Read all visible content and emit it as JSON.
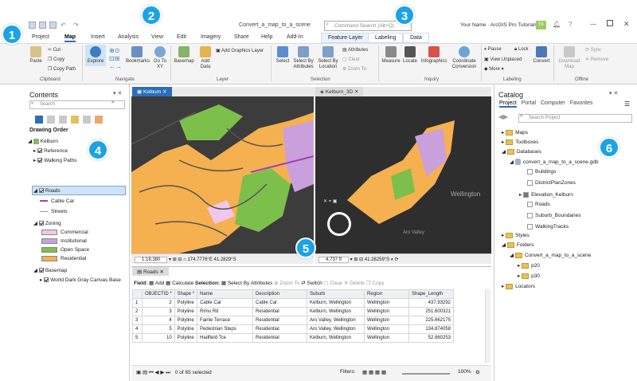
{
  "window": {
    "title": "Convert_a_map_to_a_scene",
    "app": "ArcGIS Pro Tutorials",
    "user": "Your Name",
    "user_badge": "TK",
    "help": "?"
  },
  "command_search": {
    "placeholder": "Command Search (Alt+Q)"
  },
  "ribbon_tabs": [
    "Project",
    "Map",
    "Insert",
    "Analysis",
    "View",
    "Edit",
    "Imagery",
    "Share",
    "Help",
    "Add-In"
  ],
  "active_tab": "Map",
  "context_tabs": {
    "group": "Feature Layer",
    "items": [
      "Labeling",
      "Data"
    ]
  },
  "ribbon": {
    "clipboard": {
      "label": "Clipboard",
      "paste": "Paste",
      "cut": "Cut",
      "copy": "Copy",
      "copy_path": "Copy Path"
    },
    "navigate": {
      "label": "Navigate",
      "explore": "Explore",
      "bookmarks": "Bookmarks",
      "goto": "Go To XY"
    },
    "layer": {
      "label": "Layer",
      "basemap": "Basemap",
      "add_data": "Add Data",
      "add_graphics": "Add Graphics Layer"
    },
    "selection": {
      "label": "Selection",
      "select": "Select",
      "by_attr": "Select By Attributes",
      "by_loc": "Select By Location",
      "attributes": "Attributes",
      "clear": "Clear",
      "zoom_to": "Zoom To"
    },
    "inquiry": {
      "label": "Inquiry",
      "measure": "Measure",
      "locate": "Locate",
      "infographics": "Infographics",
      "coord": "Coordinate Conversion"
    },
    "labeling": {
      "label": "Labeling",
      "pause": "Pause",
      "lock": "Lock",
      "view_unplaced": "View Unplaced",
      "more": "More",
      "convert": "Convert"
    },
    "offline": {
      "label": "Offline",
      "download": "Download Map",
      "sync": "Sync",
      "remove": "Remove"
    }
  },
  "contents": {
    "title": "Contents",
    "search_placeholder": "Search",
    "drawing_order": "Drawing Order",
    "map_name": "Kelburn",
    "layers": {
      "reference": "Reference",
      "walking": "Walking Paths",
      "roads": "Roads",
      "cable": "Cable Car",
      "streets": "Streets",
      "zoning": "Zoning",
      "zones": [
        {
          "label": "Commercial",
          "color": "#f2c6ea"
        },
        {
          "label": "Institutional",
          "color": "#c9a0dc"
        },
        {
          "label": "Open Space",
          "color": "#7cbf4a"
        },
        {
          "label": "Residential",
          "color": "#f5b050"
        }
      ],
      "basemap": "Basemap",
      "basemap_item": "World Dark Gray Canvas Base"
    }
  },
  "map_tabs": [
    "Kelburn",
    "Kelburn_3D"
  ],
  "map": {
    "scale": "1:18,380",
    "coords": "174.7776°E 41.2829°S",
    "scene_scale": "4,737 ft",
    "scene_coords": "41.28259°S",
    "label_wellington": "Wellington",
    "label_aro": "Aro Valley"
  },
  "table": {
    "tab": "Roads",
    "toolbar": {
      "field": "Field:",
      "add": "Add",
      "calculate": "Calculate",
      "selection": "Selection:",
      "select_by_attr": "Select By Attributes",
      "zoom_to": "Zoom To",
      "switch": "Switch",
      "clear": "Clear",
      "delete": "Delete",
      "copy": "Copy"
    },
    "columns": [
      "OBJECTID *",
      "Shape *",
      "Name",
      "Description",
      "Suburb",
      "Region",
      "Shape_Length"
    ],
    "rows": [
      [
        "1",
        "2",
        "Polyline",
        "Cable Car",
        "Cable Car",
        "Kelburn, Wellington",
        "Wellington",
        "437.93292"
      ],
      [
        "2",
        "3",
        "Polyline",
        "Rimu Rd",
        "Residential",
        "Kelburn, Wellington",
        "Wellington",
        "251.600321"
      ],
      [
        "3",
        "4",
        "Polyline",
        "Fairlie Terrace",
        "Residential",
        "Aro Valley, Wellington",
        "Wellington",
        "225.662175"
      ],
      [
        "4",
        "5",
        "Polyline",
        "Pedestrian Steps",
        "Residential",
        "Aro Valley, Wellington",
        "Wellington",
        "134.874058"
      ],
      [
        "5",
        "10",
        "Polyline",
        "Hadfield Tce",
        "Residential",
        "Kelburn, Wellington",
        "Wellington",
        "52.860253"
      ]
    ],
    "footer": {
      "selected": "0 of 65 selected",
      "filters": "Filters:",
      "zoom": "100%"
    }
  },
  "catalog": {
    "title": "Catalog",
    "tabs": [
      "Project",
      "Portal",
      "Computer",
      "Favorites"
    ],
    "search_placeholder": "Search Project",
    "items": {
      "maps": "Maps",
      "toolboxes": "Toolboxes",
      "databases": "Databases",
      "gdb": "convert_a_map_to_a_scene.gdb",
      "fcs": [
        "Buildings",
        "DistrictPlanZones",
        "Elevation_Kelburn",
        "Roads",
        "Suburb_Boundaries",
        "WalkingTracks"
      ],
      "styles": "Styles",
      "folders": "Folders",
      "folder_main": "Convert_a_map_to_a_scene",
      "p20": "p20",
      "p30": "p30",
      "locators": "Locators"
    }
  },
  "callouts": [
    "1",
    "2",
    "3",
    "4",
    "5",
    "6"
  ]
}
